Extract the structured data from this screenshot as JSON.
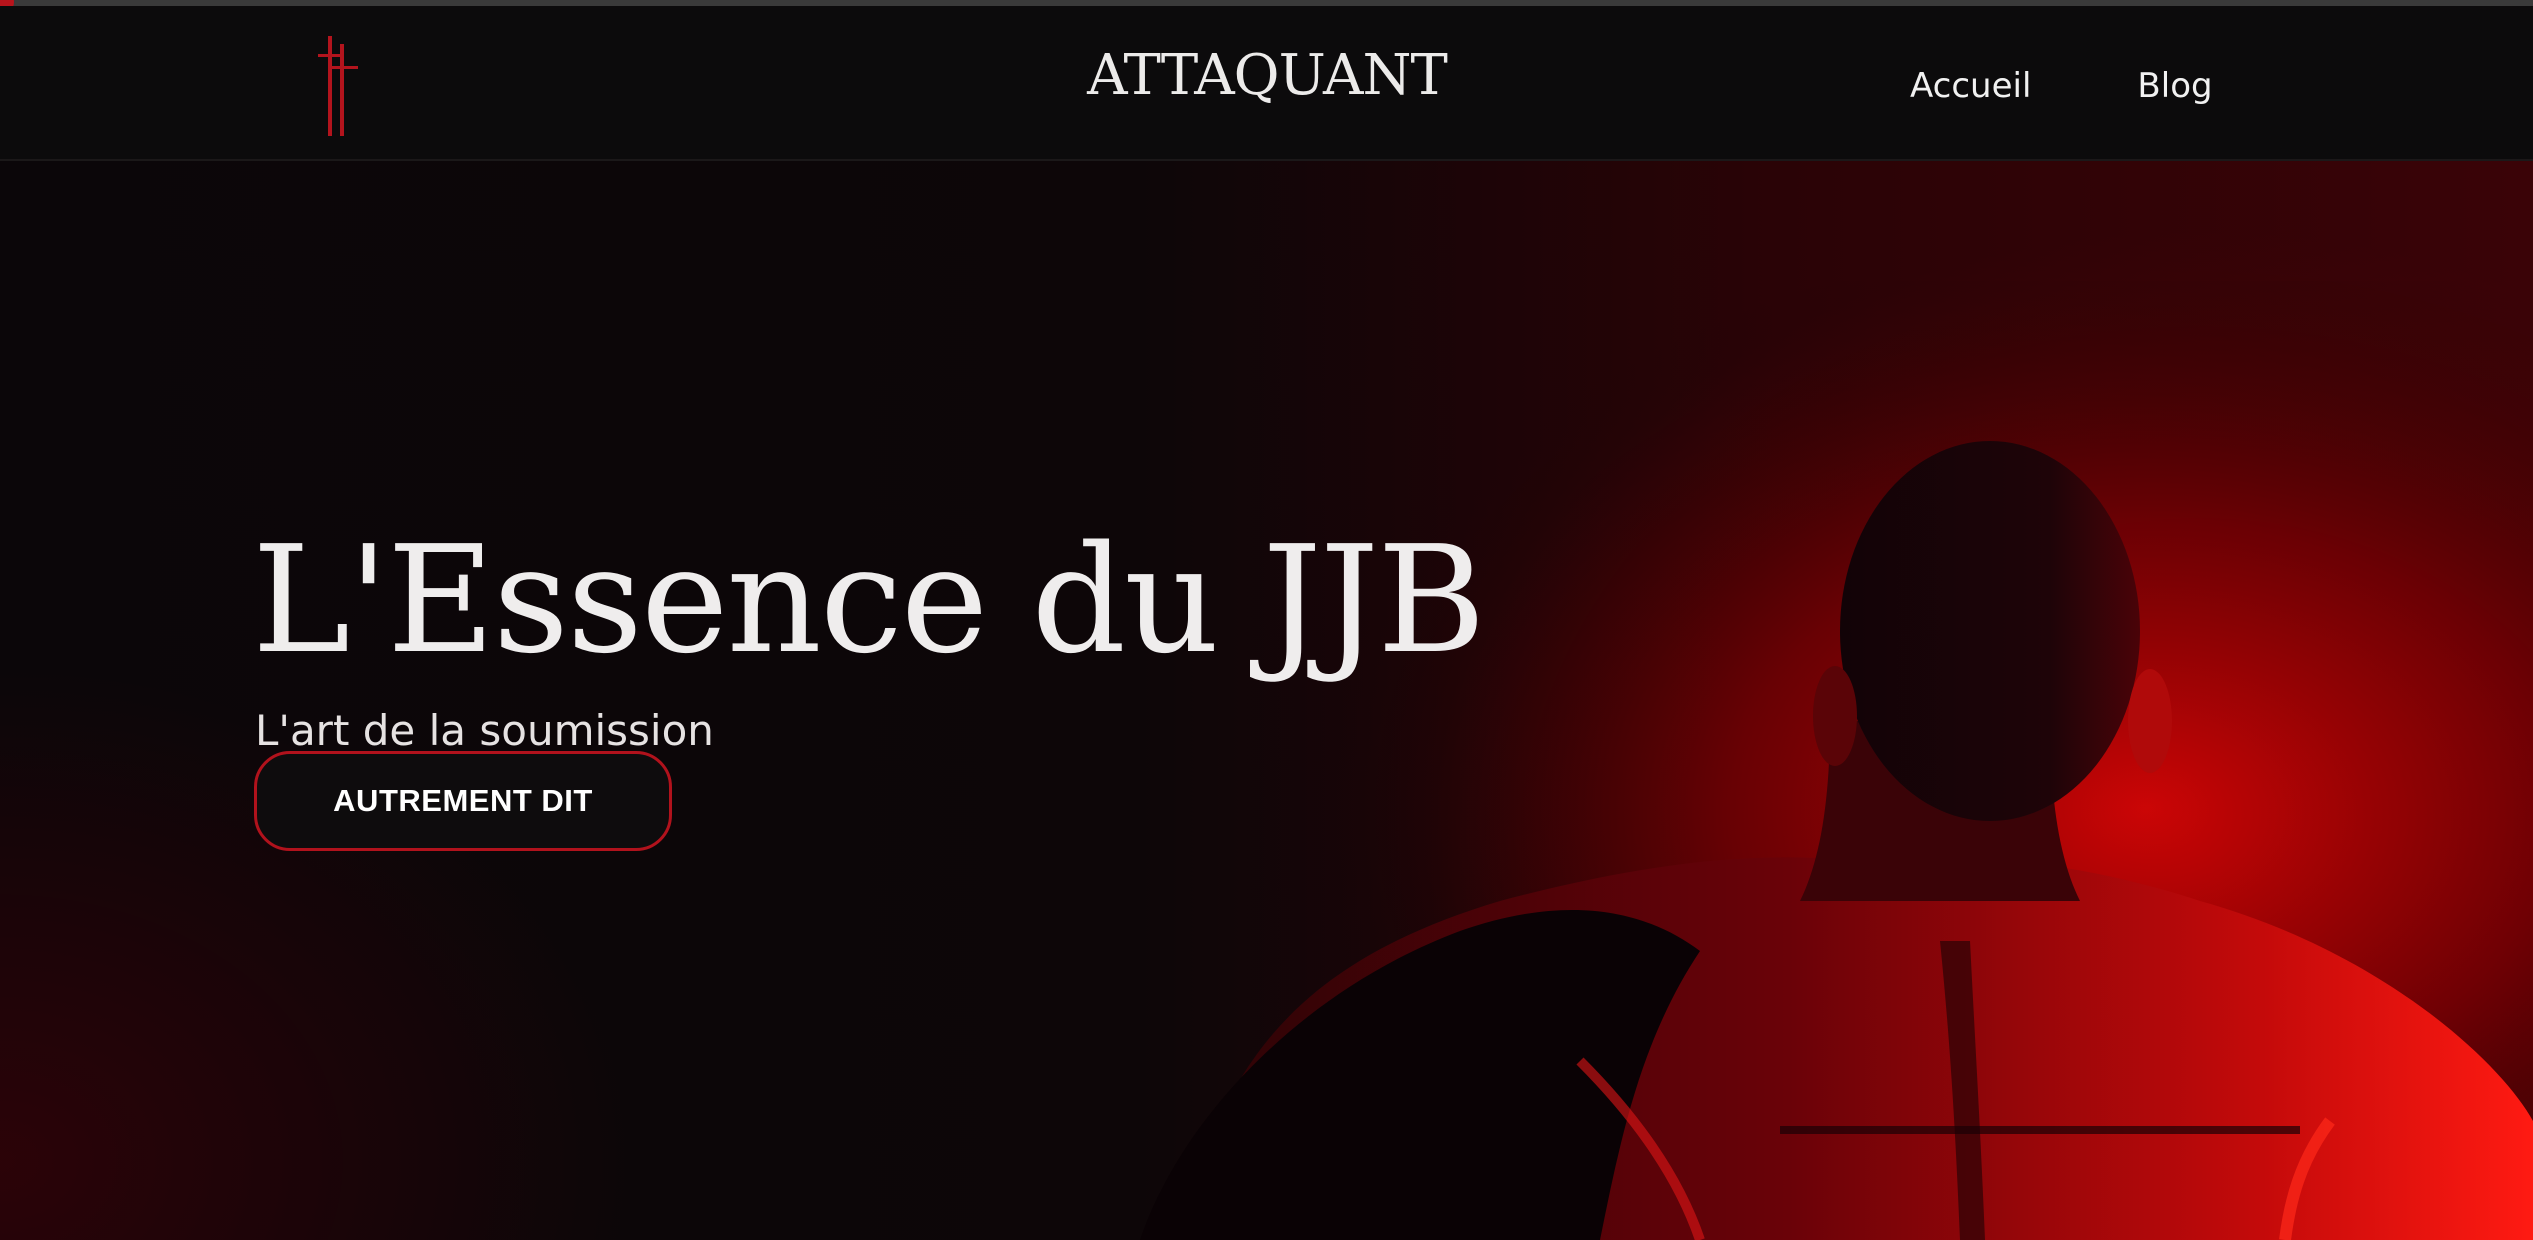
{
  "header": {
    "brand": "ATTAQUANT",
    "logo_icon": "double-cross-icon",
    "nav": [
      {
        "label": "Accueil"
      },
      {
        "label": "Blog"
      }
    ]
  },
  "hero": {
    "title": "L'Essence du JJB",
    "subtitle": "L'art de la soumission",
    "cta_label": "AUTREMENT DIT",
    "image_subject": "athlete-back-red-light"
  },
  "colors": {
    "accent": "#b1121c",
    "header_bg": "#0c0b0c",
    "hero_dark": "#0b0609",
    "hero_red": "#c00000",
    "text": "#efeded"
  }
}
